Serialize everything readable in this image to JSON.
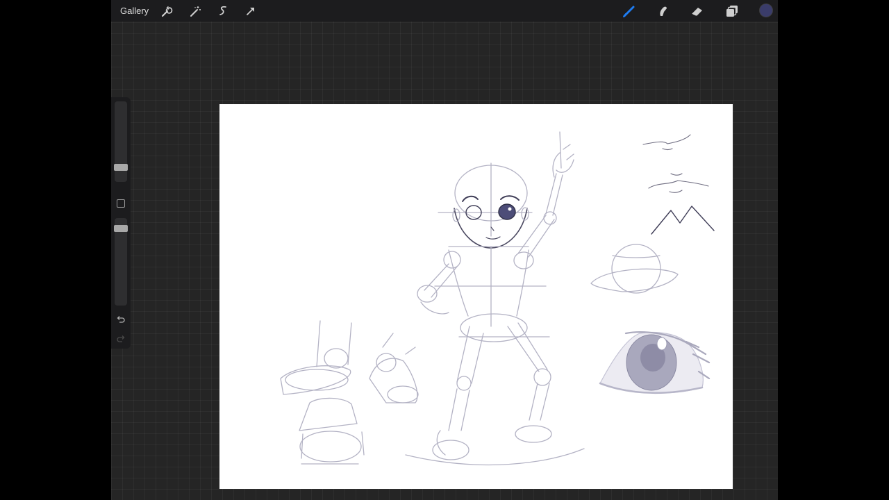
{
  "topbar": {
    "gallery_label": "Gallery",
    "left_tools": [
      "wrench-icon",
      "magic-wand-icon",
      "selection-s-icon",
      "transform-arrow-icon"
    ],
    "right_tools": [
      "brush-icon",
      "smudge-icon",
      "eraser-icon",
      "layers-icon"
    ],
    "active_tool": "brush",
    "current_color": "#3a3c6a"
  },
  "sidebar": {
    "brush_size_slider": "slider",
    "modify_button": "square",
    "opacity_slider": "slider",
    "undo": "undo-icon",
    "redo": "redo-icon"
  },
  "colors": {
    "accent": "#1e7cf2",
    "sketch": "#b3b2c4",
    "ink": "#3a3a52"
  }
}
